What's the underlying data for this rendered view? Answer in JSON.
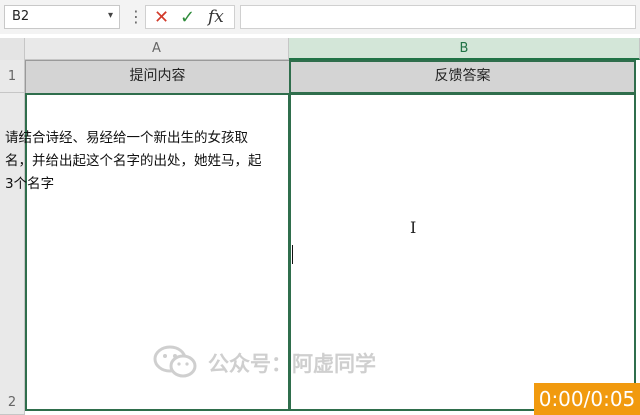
{
  "formula_bar": {
    "name_box": "B2",
    "cancel_icon": "cross-icon",
    "enter_icon": "check-icon",
    "function_label": "fx",
    "formula_value": ""
  },
  "columns": [
    "A",
    "B"
  ],
  "rows": [
    "1",
    "2"
  ],
  "cells": {
    "A1": "提问内容",
    "B1": "反馈答案",
    "A2": "请结合诗经、易经给一个新出生的女孩取名，并给出起这个名字的出处，她姓马，起3个名字",
    "B2": ""
  },
  "watermark": "公众号：阿虚同学",
  "video_timer": "0:00/0:05",
  "colors": {
    "selection_border": "#2f6e4c",
    "header_fill": "#d4d4d4",
    "timer_bg": "#f19a0e",
    "cancel": "#d23a2a",
    "enter": "#2e8b3a"
  }
}
